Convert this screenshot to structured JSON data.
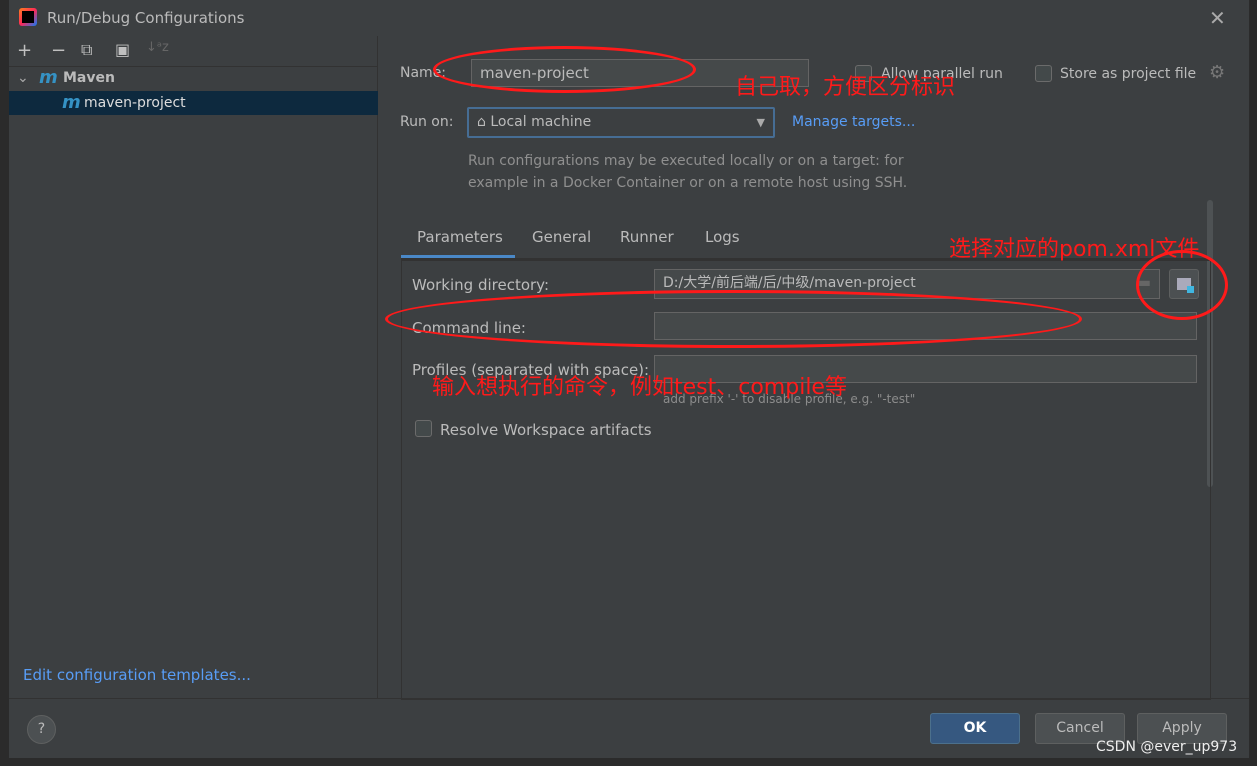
{
  "window": {
    "title": "Run/Debug Configurations",
    "close": "✕"
  },
  "toolbar": {
    "add": "+",
    "remove": "−",
    "copy": "⧉",
    "folder": "▣",
    "sort": "↓ᵃz"
  },
  "tree": {
    "group_arrow": "⌄",
    "group_label": "Maven",
    "group_icon": "m",
    "item_icon": "m",
    "item_label": "maven-project"
  },
  "left": {
    "edit_templates": "Edit configuration templates..."
  },
  "form": {
    "name_label": "Name:",
    "name_value": "maven-project",
    "allow_parallel": "Allow parallel run",
    "store_project": "Store as project file",
    "run_on_label": "Run on:",
    "run_on_value": "Local machine",
    "manage_targets": "Manage targets...",
    "run_hint_1": "Run configurations may be executed locally or on a target: for",
    "run_hint_2": "example in a Docker Container or on a remote host using SSH."
  },
  "tabs": [
    {
      "label": "Parameters",
      "active": true
    },
    {
      "label": "General"
    },
    {
      "label": "Runner"
    },
    {
      "label": "Logs"
    }
  ],
  "params": {
    "working_dir_label": "Working directory:",
    "working_dir_value": "D:/大学/前后端/后/中级/maven-project",
    "command_line_label": "Command line:",
    "command_line_value": "",
    "profiles_label": "Profiles (separated with space):",
    "profiles_value": "",
    "profiles_hint": "add prefix '-' to disable profile, e.g. \"-test\"",
    "resolve_workspace": "Resolve Workspace artifacts"
  },
  "footer": {
    "help": "?",
    "ok": "OK",
    "cancel": "Cancel",
    "apply": "Apply"
  },
  "annotations": {
    "name_note": "自己取，方便区分标识",
    "pom_note": "选择对应的pom.xml文件",
    "command_note": "输入想执行的命令，例如test、compile等",
    "color": "#ff1a1a"
  },
  "watermark": "CSDN @ever_up973",
  "colors": {
    "accent": "#365880",
    "link": "#589df6",
    "selection": "#0d293e",
    "background": "#3c3f41"
  }
}
